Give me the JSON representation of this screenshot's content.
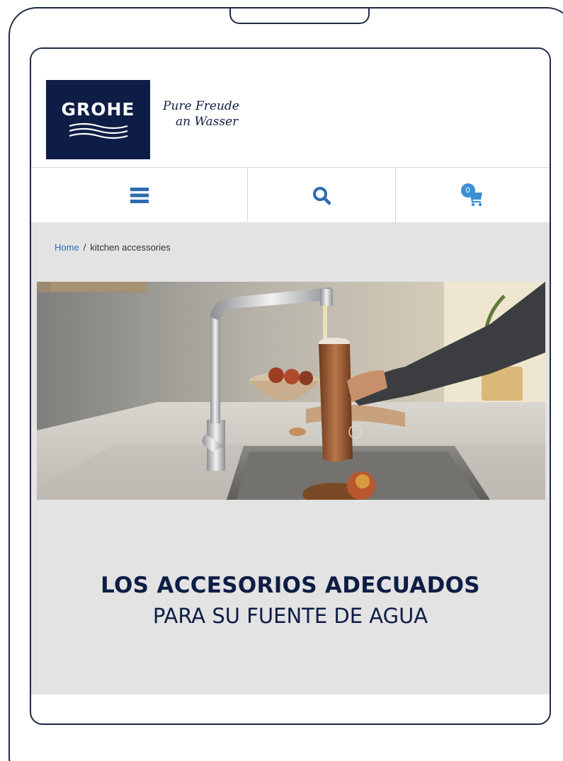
{
  "header": {
    "brand": "GROHE",
    "tagline_line1": "Pure Freude",
    "tagline_line2": "an Wasser"
  },
  "nav": {
    "menu_icon": "hamburger-menu-icon",
    "search_icon": "search-icon",
    "cart_icon": "shopping-cart-icon",
    "cart_count": "0"
  },
  "breadcrumb": {
    "home": "Home",
    "separator": "/",
    "current": "kitchen accessories"
  },
  "hero": {
    "headline": "LOS ACCESORIOS ADECUADOS",
    "subheadline": "PARA SU FUENTE DE AGUA"
  },
  "colors": {
    "brand_navy": "#0e1d45",
    "accent_blue": "#2d6fb8",
    "content_bg": "#e3e3e3"
  }
}
